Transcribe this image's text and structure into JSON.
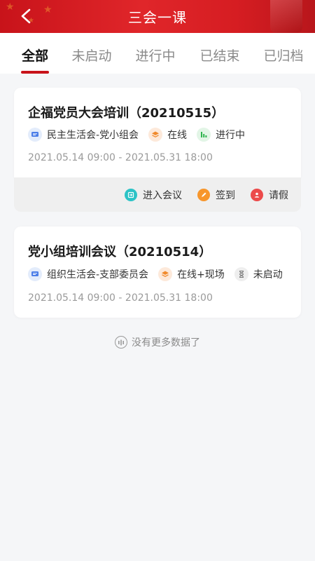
{
  "header": {
    "title": "三会一课"
  },
  "tabs": [
    {
      "label": "全部",
      "active": true
    },
    {
      "label": "未启动",
      "active": false
    },
    {
      "label": "进行中",
      "active": false
    },
    {
      "label": "已结束",
      "active": false
    },
    {
      "label": "已归档",
      "active": false
    }
  ],
  "meetings": [
    {
      "title": "企福党员大会培训（20210515）",
      "type": "民主生活会-党小组会",
      "mode": "在线",
      "status": "进行中",
      "date_range": "2021.05.14 09:00 - 2021.05.31 18:00",
      "actions": [
        {
          "label": "进入会议",
          "icon": "enter-icon"
        },
        {
          "label": "签到",
          "icon": "sign-in-icon"
        },
        {
          "label": "请假",
          "icon": "leave-icon"
        }
      ]
    },
    {
      "title": "党小组培训会议（20210514）",
      "type": "组织生活会-支部委员会",
      "mode": "在线+现场",
      "status": "未启动",
      "date_range": "2021.05.14 09:00 - 2021.05.31 18:00"
    }
  ],
  "footer": {
    "no_more_text": "没有更多数据了"
  },
  "colors": {
    "brand_red": "#c8131a",
    "accent_teal": "#2cc3c6",
    "accent_orange": "#f7962c"
  }
}
